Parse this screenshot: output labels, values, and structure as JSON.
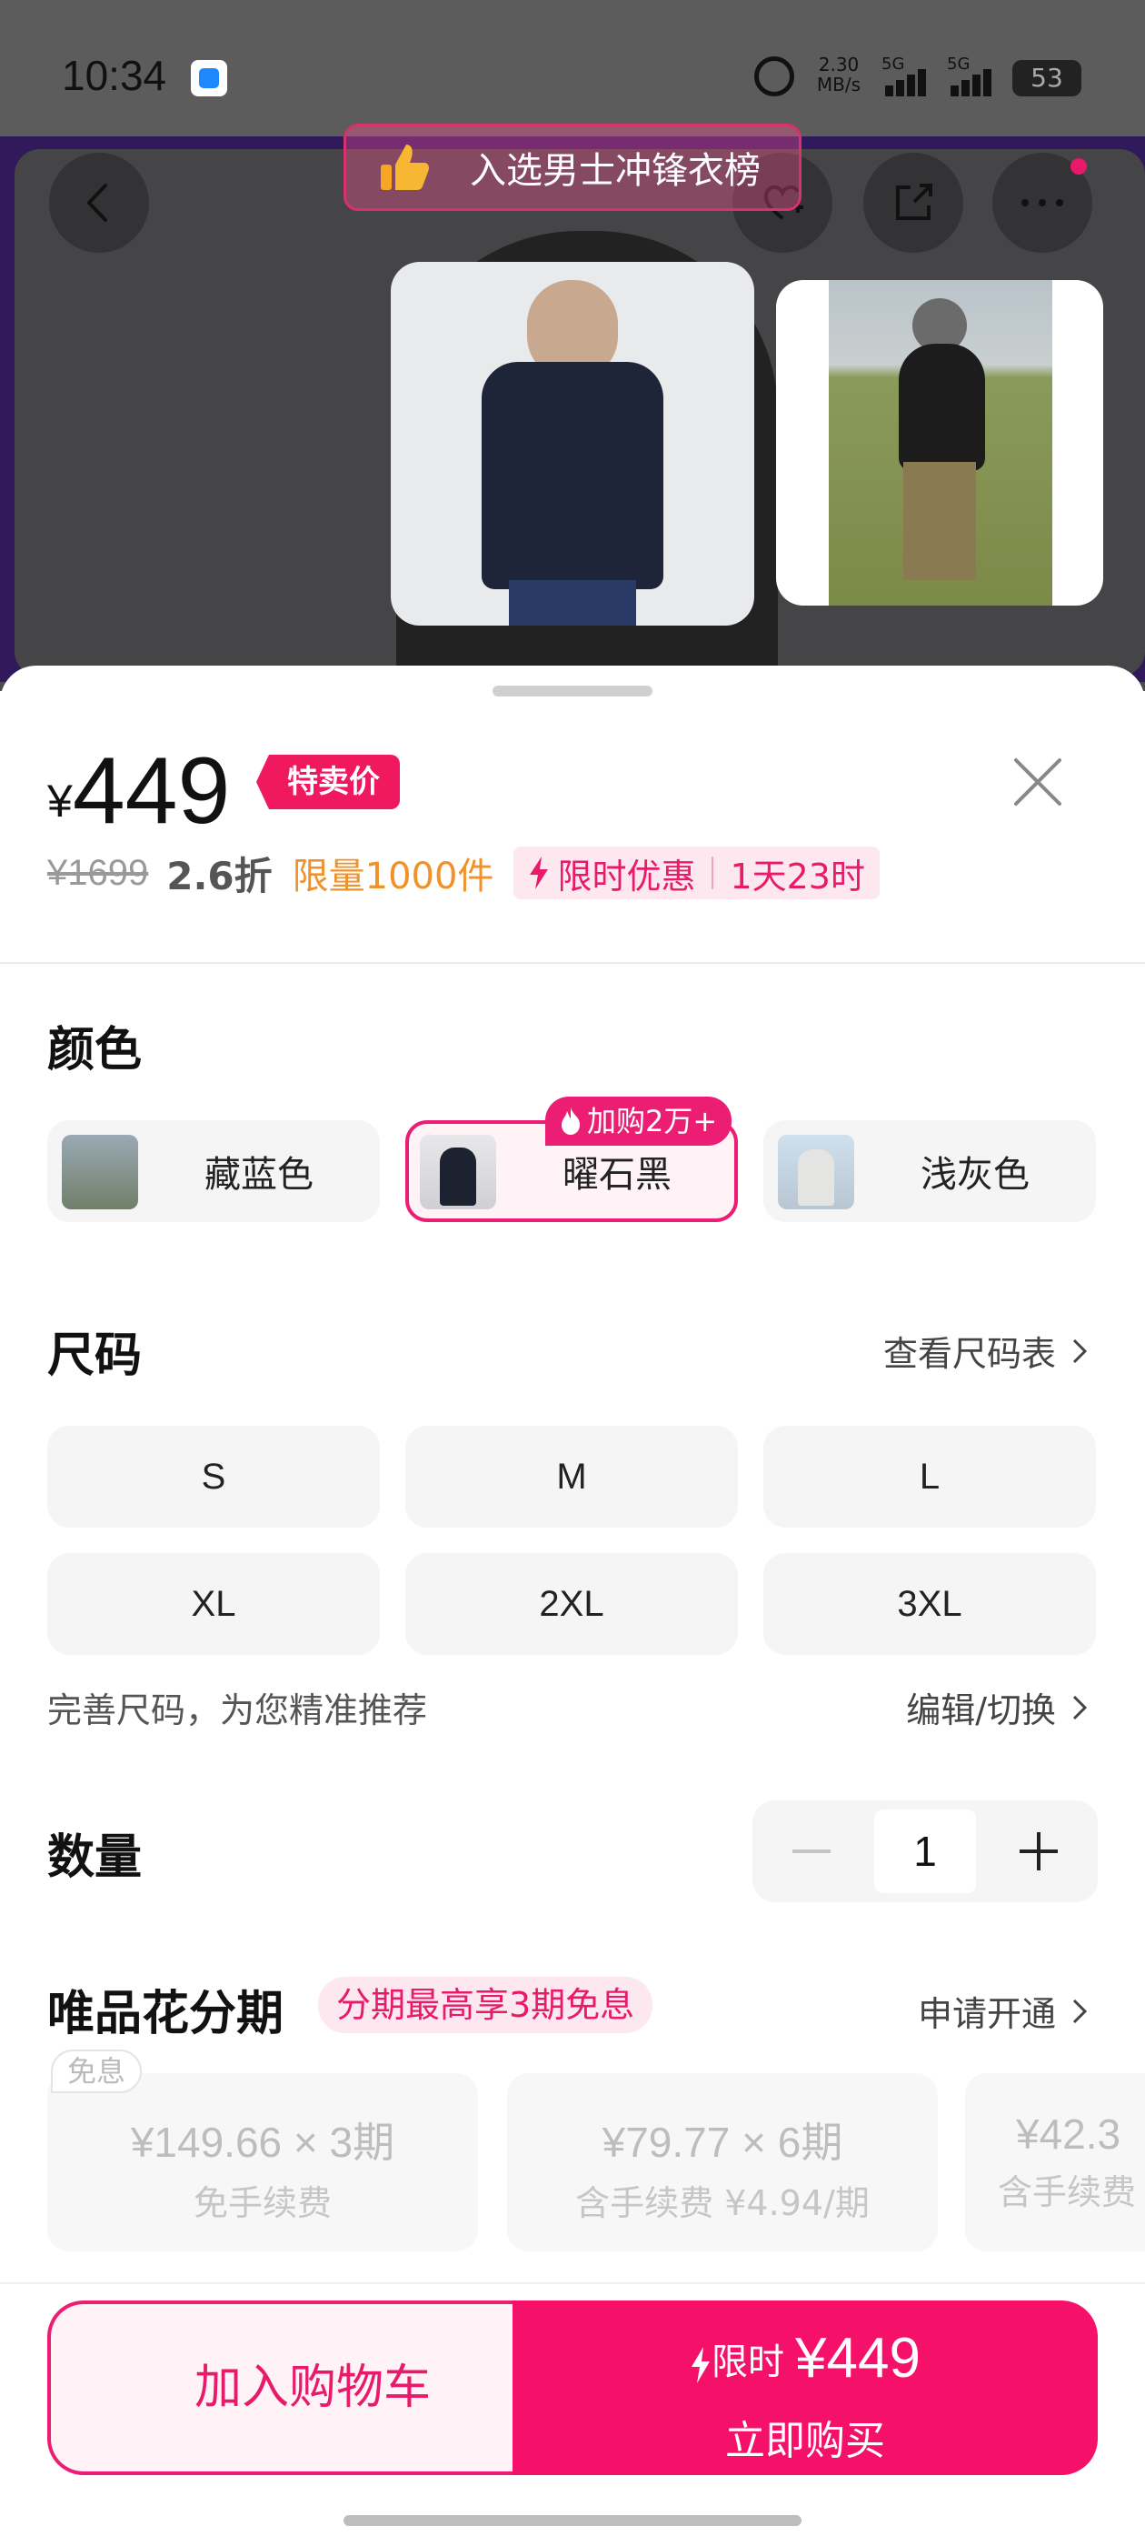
{
  "status_bar": {
    "time": "10:34",
    "net_speed_value": "2.30",
    "net_speed_unit": "MB/s",
    "signal_1": "5G",
    "signal_2": "5G",
    "battery": "53",
    "icons": [
      "app-notification-icon",
      "alarm-icon",
      "signal-icon",
      "battery-icon"
    ]
  },
  "header": {
    "rank_badge": "入选男士冲锋衣榜",
    "icons": [
      "back-icon",
      "favorite-add-icon",
      "share-icon",
      "more-icon"
    ]
  },
  "product": {
    "currency": "¥",
    "price": "449",
    "special_tag": "特卖价",
    "original_price": "¥1699",
    "discount": "2.6折",
    "limit_qty": "限量1000件",
    "flash_label": "限时优惠",
    "flash_countdown": "1天23时"
  },
  "color_section": {
    "title": "颜色",
    "options": [
      {
        "label": "藏蓝色",
        "selected": false
      },
      {
        "label": "曜石黑",
        "selected": true,
        "badge": "加购2万+"
      },
      {
        "label": "浅灰色",
        "selected": false
      }
    ]
  },
  "size_section": {
    "title": "尺码",
    "chart_link": "查看尺码表",
    "sizes": [
      "S",
      "M",
      "L",
      "XL",
      "2XL",
      "3XL"
    ],
    "hint": "完善尺码，为您精准推荐",
    "edit_link": "编辑/切换"
  },
  "quantity_section": {
    "title": "数量",
    "value": "1"
  },
  "installment_section": {
    "title": "唯品花分期",
    "tag": "分期最高享3期免息",
    "apply_link": "申请开通",
    "free_tag": "免息",
    "plans": [
      {
        "amount": "¥149.66 × 3期",
        "fee": "免手续费"
      },
      {
        "amount": "¥79.77 × 6期",
        "fee": "含手续费 ¥4.94/期"
      },
      {
        "amount": "¥42.3",
        "fee": "含手续费"
      }
    ]
  },
  "bottom_bar": {
    "cart_label": "加入购物车",
    "buy_flash": "限时",
    "buy_price": "¥449",
    "buy_label": "立即购买"
  },
  "colors": {
    "accent": "#F0185F",
    "flash_bg": "#FDE8F0",
    "limit_orange": "#F0912A",
    "overlay_purple": "#311A5C"
  }
}
